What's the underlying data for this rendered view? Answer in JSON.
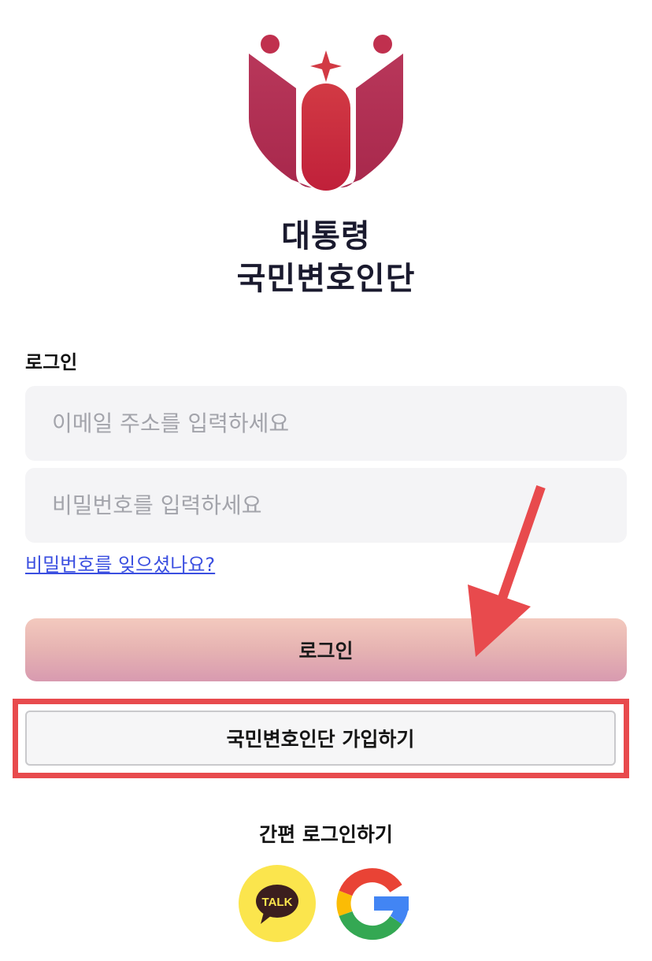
{
  "organization": {
    "name_line1": "대통령",
    "name_line2": "국민변호인단"
  },
  "login_form": {
    "section_label": "로그인",
    "email_placeholder": "이메일 주소를 입력하세요",
    "password_placeholder": "비밀번호를 입력하세요",
    "forgot_password_link": "비밀번호를 잊으셨나요?",
    "login_button": "로그인",
    "signup_button": "국민변호인단 가입하기"
  },
  "social_login": {
    "label": "간편 로그인하기",
    "kakao_badge_text": "TALK",
    "providers": [
      "kakao-talk-icon",
      "google-icon"
    ]
  },
  "colors": {
    "brand_crimson": "#c02f4a",
    "annotation_red": "#e84a4d",
    "link_blue": "#3b4fe0",
    "kakao_yellow": "#fbe54d"
  }
}
